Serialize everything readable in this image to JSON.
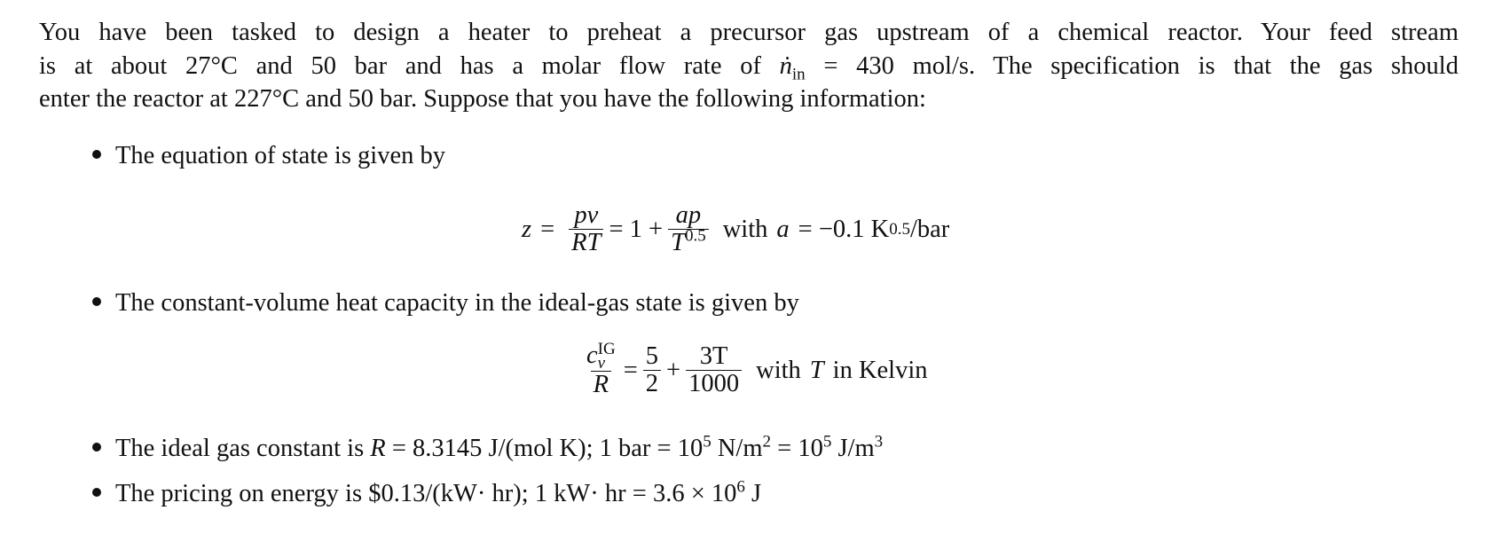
{
  "intro": {
    "line1": "You have been tasked to design a heater to preheat a precursor gas upstream of a chemical reactor. Your feed stream",
    "line2_a": "is at about 27°C and 50 bar and has a molar flow rate of ",
    "line2_var": "ṅ",
    "line2_sub": "in",
    "line2_b": " = 430 mol/s. The specification is that the gas should",
    "line3": "enter the reactor at 227°C and 50 bar. Suppose that you have the following information:"
  },
  "bullets": [
    {
      "text": "The equation of state is given by",
      "equation": {
        "lhs": "z",
        "eq": "=",
        "frac1_num": "pv",
        "frac1_den": "RT",
        "mid": "= 1 +",
        "frac2_num": "ap",
        "frac2_den_base": "T",
        "frac2_den_exp": "0.5",
        "tail_with": "with",
        "tail_var": "a",
        "tail_value": "= −0.1 K",
        "tail_exp": "0.5",
        "tail_unit": "/bar"
      }
    },
    {
      "text": "The constant-volume heat capacity in the ideal-gas state is given by",
      "equation": {
        "frac1_num_base": "c",
        "frac1_num_sub": "v",
        "frac1_num_sup": "IG",
        "frac1_den": "R",
        "eq": "=",
        "frac2_num": "5",
        "frac2_den": "2",
        "plus": "+",
        "frac3_num": "3T",
        "frac3_den": "1000",
        "tail_with": "with",
        "tail_var": "T",
        "tail_rest": "in Kelvin"
      }
    },
    {
      "text_a": "The ideal gas constant is ",
      "var": "R",
      "text_b": " = 8.3145 J/(mol K); 1 bar = 10",
      "exp1": "5",
      "text_c": " N/m",
      "exp2": "2",
      "text_d": " = 10",
      "exp3": "5",
      "text_e": " J/m",
      "exp4": "3"
    },
    {
      "text_a": "The pricing on energy is $0.13/(kW· hr); 1 kW· hr = 3.6 × 10",
      "exp1": "6",
      "text_b": " J"
    }
  ]
}
